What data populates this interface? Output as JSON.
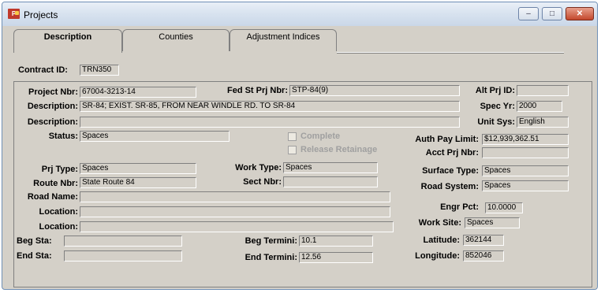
{
  "window": {
    "title": "Projects",
    "icon": "projects-app-icon"
  },
  "title_controls": {
    "minimize": "–",
    "maximize": "□",
    "close": "✕"
  },
  "tabs": [
    {
      "label": "Description",
      "active": true
    },
    {
      "label": "Counties",
      "active": false
    },
    {
      "label": "Adjustment Indices",
      "active": false
    }
  ],
  "contract": {
    "label": "Contract ID:",
    "value": "TRN350"
  },
  "fields": {
    "project_nbr": {
      "label": "Project Nbr:",
      "value": "67004-3213-14"
    },
    "fed_st_prj_nbr": {
      "label": "Fed St Prj Nbr:",
      "value": "STP-84(9)"
    },
    "alt_prj_id": {
      "label": "Alt Prj ID:",
      "value": ""
    },
    "description1": {
      "label": "Description:",
      "value": "SR-84; EXIST. SR-85, FROM NEAR WINDLE RD. TO SR-84"
    },
    "spec_yr": {
      "label": "Spec Yr:",
      "value": "2000"
    },
    "description2": {
      "label": "Description:",
      "value": ""
    },
    "unit_sys": {
      "label": "Unit Sys:",
      "value": "English"
    },
    "status": {
      "label": "Status:",
      "value": "Spaces"
    },
    "complete": {
      "label": "Complete",
      "checked": false
    },
    "release_retainage": {
      "label": "Release Retainage",
      "checked": false
    },
    "auth_pay_limit": {
      "label": "Auth Pay Limit:",
      "value": "$12,939,362.51"
    },
    "acct_prj_nbr": {
      "label": "Acct Prj Nbr:",
      "value": ""
    },
    "prj_type": {
      "label": "Prj Type:",
      "value": "Spaces"
    },
    "work_type": {
      "label": "Work Type:",
      "value": "Spaces"
    },
    "surface_type": {
      "label": "Surface Type:",
      "value": "Spaces"
    },
    "route_nbr": {
      "label": "Route Nbr:",
      "value": "State Route 84"
    },
    "sect_nbr": {
      "label": "Sect Nbr:",
      "value": ""
    },
    "road_system": {
      "label": "Road System:",
      "value": "Spaces"
    },
    "road_name": {
      "label": "Road Name:",
      "value": ""
    },
    "location1": {
      "label": "Location:",
      "value": ""
    },
    "engr_pct": {
      "label": "Engr Pct:",
      "value": "10.0000"
    },
    "location2": {
      "label": "Location:",
      "value": ""
    },
    "work_site": {
      "label": "Work Site:",
      "value": "Spaces"
    },
    "beg_sta": {
      "label": "Beg Sta:",
      "value": ""
    },
    "beg_termini": {
      "label": "Beg Termini:",
      "value": "10.1"
    },
    "latitude": {
      "label": "Latitude:",
      "value": "362144"
    },
    "end_sta": {
      "label": "End Sta:",
      "value": ""
    },
    "end_termini": {
      "label": "End Termini:",
      "value": "12.56"
    },
    "longitude": {
      "label": "Longitude:",
      "value": "852046"
    }
  }
}
